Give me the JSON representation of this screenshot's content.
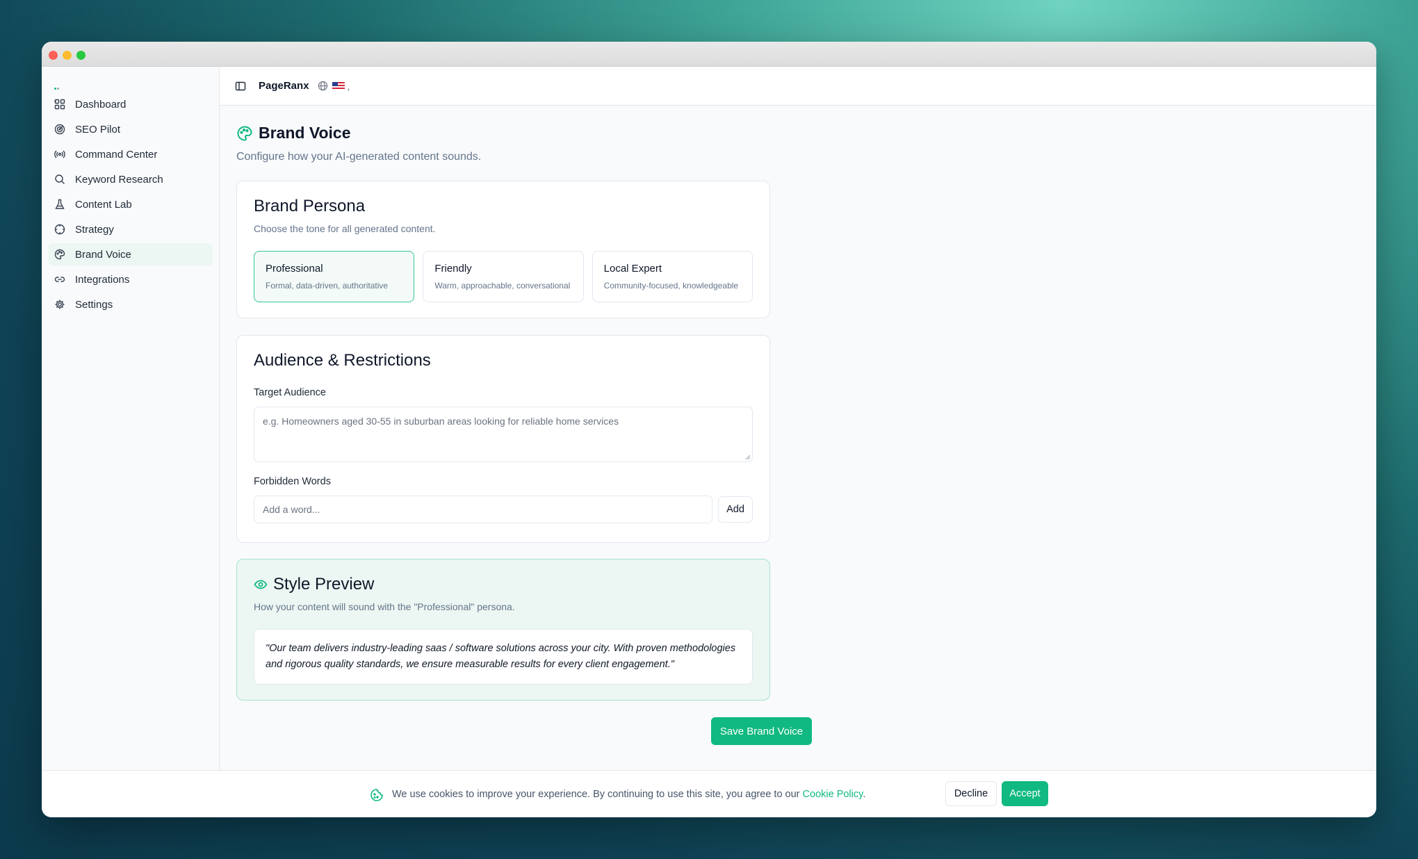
{
  "app": {
    "name": "PageRanx"
  },
  "sidebar": {
    "items": [
      {
        "label": "Dashboard",
        "icon": "dashboard-grid-icon"
      },
      {
        "label": "SEO Pilot",
        "icon": "radar-icon"
      },
      {
        "label": "Command Center",
        "icon": "broadcast-icon"
      },
      {
        "label": "Keyword Research",
        "icon": "search-icon"
      },
      {
        "label": "Content Lab",
        "icon": "flask-icon"
      },
      {
        "label": "Strategy",
        "icon": "crosshair-icon"
      },
      {
        "label": "Brand Voice",
        "icon": "palette-icon",
        "active": true
      },
      {
        "label": "Integrations",
        "icon": "link-icon"
      },
      {
        "label": "Settings",
        "icon": "gear-icon"
      }
    ]
  },
  "topbar": {
    "locale_suffix": ","
  },
  "page": {
    "title": "Brand Voice",
    "subtitle": "Configure how your AI-generated content sounds."
  },
  "persona": {
    "title": "Brand Persona",
    "description": "Choose the tone for all generated content.",
    "options": [
      {
        "name": "Professional",
        "desc": "Formal, data-driven, authoritative",
        "selected": true
      },
      {
        "name": "Friendly",
        "desc": "Warm, approachable, conversational",
        "selected": false
      },
      {
        "name": "Local Expert",
        "desc": "Community-focused, knowledgeable",
        "selected": false
      }
    ]
  },
  "audience": {
    "title": "Audience & Restrictions",
    "target_label": "Target Audience",
    "target_placeholder": "e.g. Homeowners aged 30-55 in suburban areas looking for reliable home services",
    "forbidden_label": "Forbidden Words",
    "word_placeholder": "Add a word...",
    "add_label": "Add"
  },
  "preview": {
    "title": "Style Preview",
    "description": "How your content will sound with the \"Professional\" persona.",
    "quote": "\"Our team delivers industry-leading saas / software solutions across your city. With proven methodologies and rigorous quality standards, we ensure measurable results for every client engagement.\""
  },
  "save_label": "Save Brand Voice",
  "cookie": {
    "text": "We use cookies to improve your experience. By continuing to use this site, you agree to our ",
    "link": "Cookie Policy",
    "period": ".",
    "decline": "Decline",
    "accept": "Accept"
  },
  "colors": {
    "accent": "#10b981",
    "selected_bg": "#f3faf7",
    "preview_bg": "#ecf6f2"
  }
}
